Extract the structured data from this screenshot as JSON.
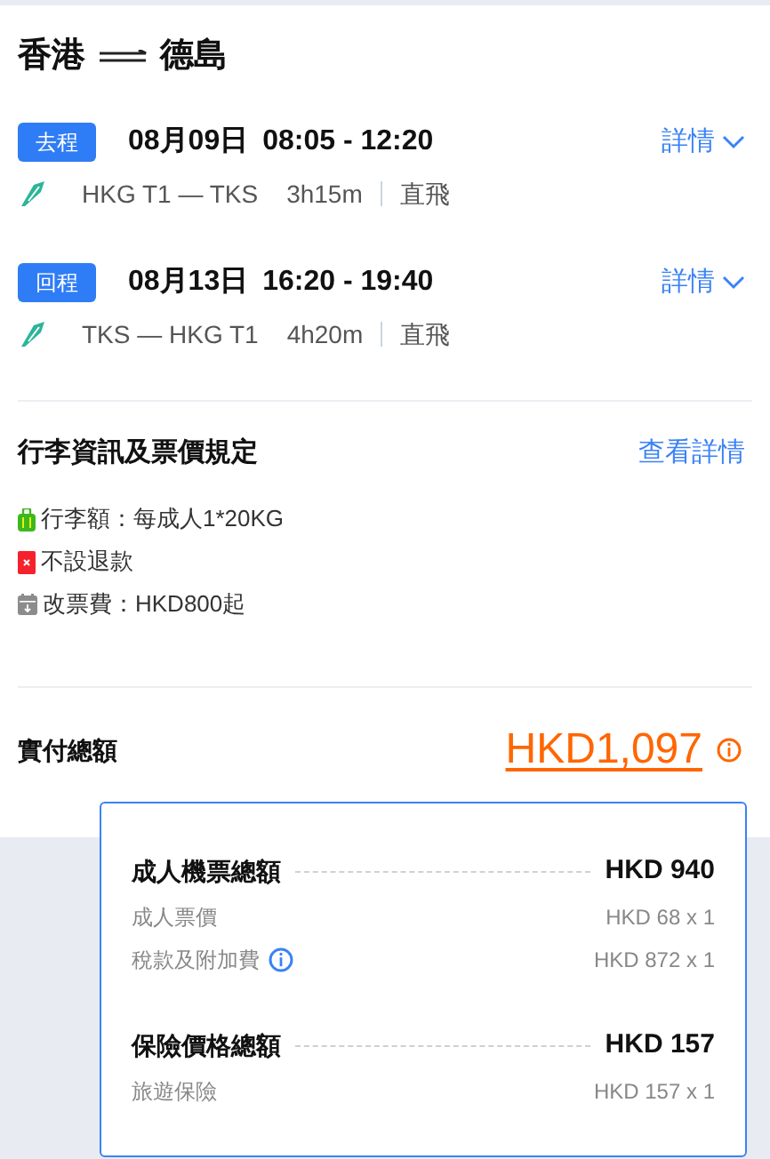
{
  "header": {
    "origin": "香港",
    "destination": "德島"
  },
  "flights": [
    {
      "tag": "去程",
      "date": "08月09日",
      "times": "08:05 - 12:20",
      "details_link": "詳情",
      "route": "HKG T1 — TKS",
      "duration": "3h15m",
      "stops": "直飛"
    },
    {
      "tag": "回程",
      "date": "08月13日",
      "times": "16:20 - 19:40",
      "details_link": "詳情",
      "route": "TKS — HKG T1",
      "duration": "4h20m",
      "stops": "直飛"
    }
  ],
  "rules": {
    "title": "行李資訊及票價規定",
    "link": "查看詳情",
    "items": [
      {
        "kind": "baggage",
        "text": "行李額：每成人1*20KG"
      },
      {
        "kind": "refund",
        "text": "不設退款"
      },
      {
        "kind": "change",
        "text": "改票費：HKD800起"
      }
    ]
  },
  "total": {
    "label": "實付總額",
    "amount": "HKD1,097"
  },
  "breakdown": [
    {
      "title": "成人機票總額",
      "amount": "HKD 940",
      "items": [
        {
          "label": "成人票價",
          "amount": "HKD 68 x 1",
          "info": false
        },
        {
          "label": "稅款及附加費",
          "amount": "HKD 872 x 1",
          "info": true
        }
      ]
    },
    {
      "title": "保險價格總額",
      "amount": "HKD 157",
      "items": [
        {
          "label": "旅遊保險",
          "amount": "HKD 157 x 1",
          "info": false
        }
      ]
    }
  ]
}
